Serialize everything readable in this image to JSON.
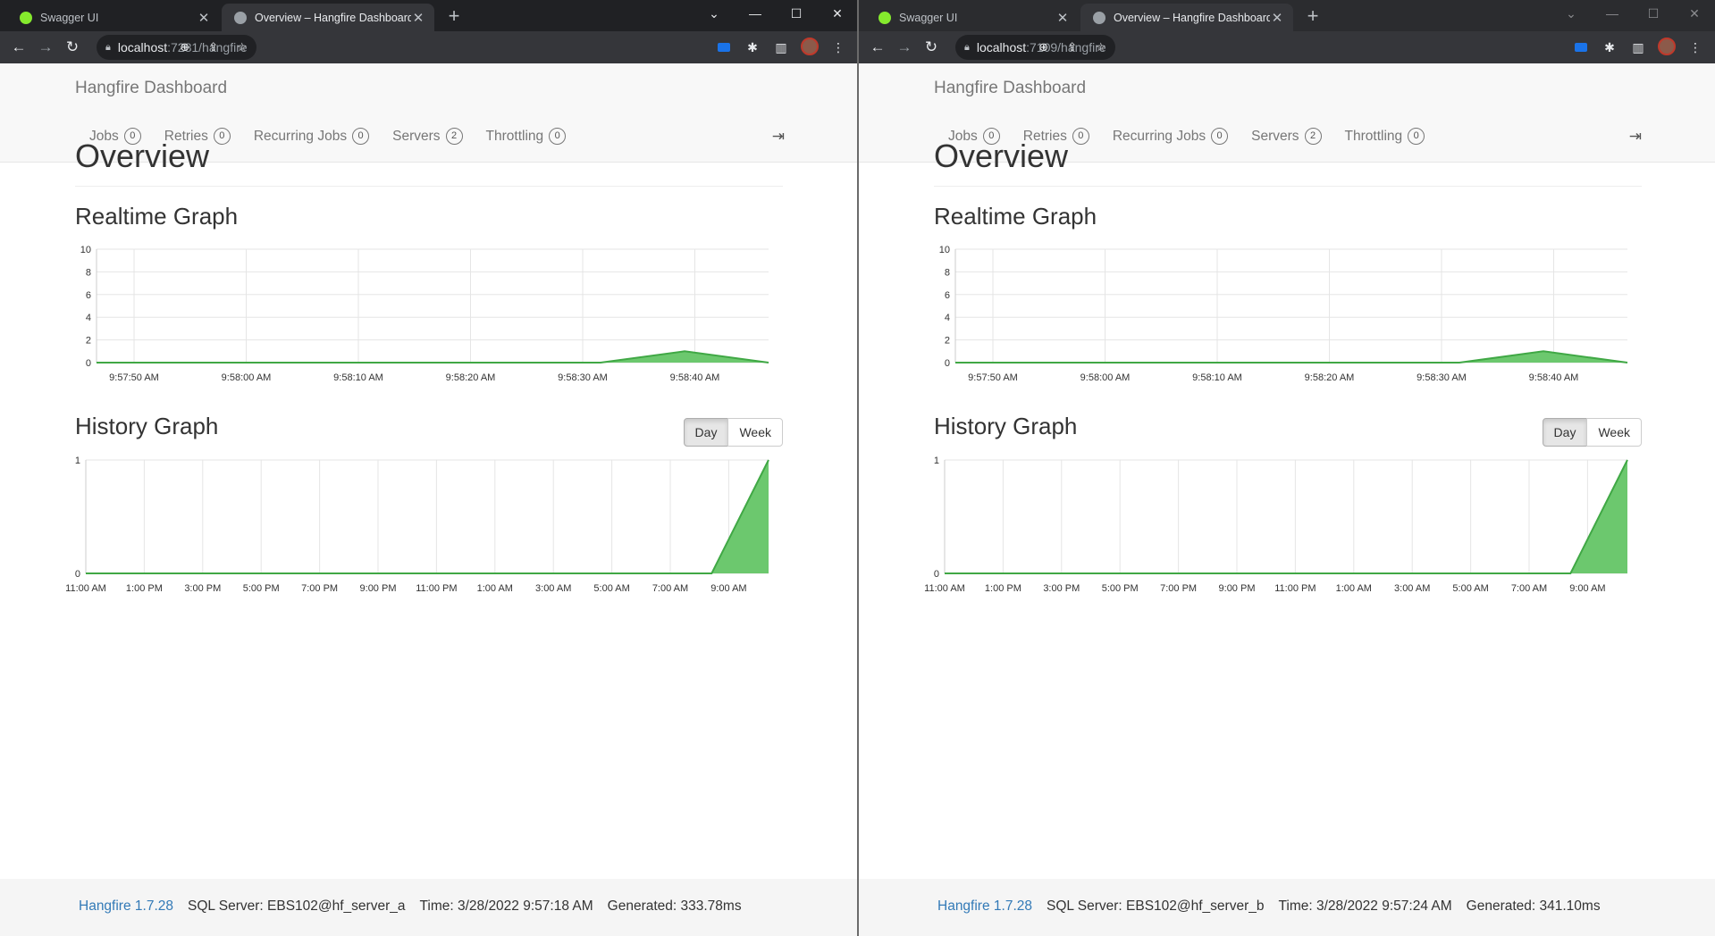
{
  "windows": [
    {
      "tabs": [
        {
          "label": "Swagger UI",
          "close": "✕"
        },
        {
          "label": "Overview – Hangfire Dashboard",
          "close": "✕"
        }
      ],
      "url": {
        "host": "localhost",
        "path": ":7281/hangfire"
      },
      "window_controls": [
        "⌄",
        "—",
        "☐",
        "✕"
      ],
      "dashboard": {
        "brand": "Hangfire Dashboard",
        "nav": [
          {
            "label": "Jobs",
            "count": "0"
          },
          {
            "label": "Retries",
            "count": "0"
          },
          {
            "label": "Recurring Jobs",
            "count": "0"
          },
          {
            "label": "Servers",
            "count": "2"
          },
          {
            "label": "Throttling",
            "count": "0"
          }
        ],
        "page_title": "Overview",
        "realtime_title": "Realtime Graph",
        "history_title": "History Graph",
        "day_button": "Day",
        "week_button": "Week"
      },
      "footer": {
        "version": "Hangfire 1.7.28",
        "storage": "SQL Server: EBS102@hf_server_a",
        "time": "Time: 3/28/2022 9:57:18 AM",
        "generated": "Generated: 333.78ms"
      }
    },
    {
      "tabs": [
        {
          "label": "Swagger UI",
          "close": "✕"
        },
        {
          "label": "Overview – Hangfire Dashboard",
          "close": "✕"
        }
      ],
      "url": {
        "host": "localhost",
        "path": ":7109/hangfire"
      },
      "window_controls": [
        "⌄",
        "—",
        "☐",
        "✕"
      ],
      "dashboard": {
        "brand": "Hangfire Dashboard",
        "nav": [
          {
            "label": "Jobs",
            "count": "0"
          },
          {
            "label": "Retries",
            "count": "0"
          },
          {
            "label": "Recurring Jobs",
            "count": "0"
          },
          {
            "label": "Servers",
            "count": "2"
          },
          {
            "label": "Throttling",
            "count": "0"
          }
        ],
        "page_title": "Overview",
        "realtime_title": "Realtime Graph",
        "history_title": "History Graph",
        "day_button": "Day",
        "week_button": "Week"
      },
      "footer": {
        "version": "Hangfire 1.7.28",
        "storage": "SQL Server: EBS102@hf_server_b",
        "time": "Time: 3/28/2022 9:57:24 AM",
        "generated": "Generated: 341.10ms"
      }
    }
  ],
  "colors": {
    "series_fill": "#6cc86e",
    "series_line": "#40a845",
    "link": "#337ab7"
  },
  "chart_data": [
    {
      "type": "area",
      "title": "Realtime Graph",
      "x": [
        "9:57:50 AM",
        "9:58:00 AM",
        "9:58:10 AM",
        "9:58:20 AM",
        "9:58:30 AM",
        "9:58:40 AM"
      ],
      "series": [
        {
          "values": [
            0,
            0,
            0,
            0,
            0,
            0,
            0,
            1,
            0
          ]
        }
      ],
      "ylim": [
        0,
        10
      ],
      "yticks": [
        "0",
        "2",
        "4",
        "6",
        "8",
        "10"
      ],
      "grid": true
    },
    {
      "type": "area",
      "title": "History Graph",
      "x": [
        "11:00 AM",
        "1:00 PM",
        "3:00 PM",
        "5:00 PM",
        "7:00 PM",
        "9:00 PM",
        "11:00 PM",
        "1:00 AM",
        "3:00 AM",
        "5:00 AM",
        "7:00 AM",
        "9:00 AM"
      ],
      "series": [
        {
          "values": [
            0,
            0,
            0,
            0,
            0,
            0,
            0,
            0,
            0,
            0,
            0,
            0,
            1
          ]
        }
      ],
      "ylim": [
        0,
        1
      ],
      "yticks": [
        "0",
        "1"
      ],
      "grid": true
    }
  ]
}
